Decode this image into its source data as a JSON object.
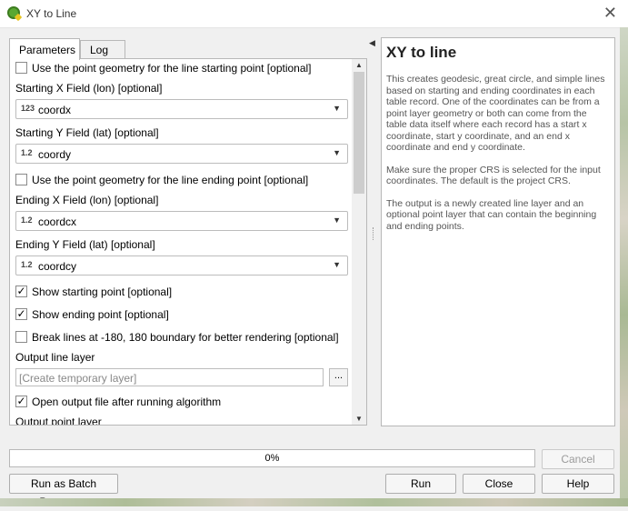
{
  "window": {
    "title": "XY to Line",
    "close_glyph": "✕",
    "app_icon": "qgis-logo-icon"
  },
  "tabs": [
    {
      "label": "Parameters",
      "active": true
    },
    {
      "label": "Log",
      "active": false
    }
  ],
  "params": {
    "use_start_geom": {
      "label": "Use the point geometry for the line starting point [optional]",
      "checked": false
    },
    "start_x": {
      "label": "Starting X Field (lon) [optional]",
      "type_badge": "123",
      "value": "coordx"
    },
    "start_y": {
      "label": "Starting Y Field (lat) [optional]",
      "type_badge": "1.2",
      "value": "coordy"
    },
    "use_end_geom": {
      "label": "Use the point geometry for the line ending point [optional]",
      "checked": false
    },
    "end_x": {
      "label": "Ending X Field (lon) [optional]",
      "type_badge": "1.2",
      "value": "coordcx"
    },
    "end_y": {
      "label": "Ending Y Field (lat) [optional]",
      "type_badge": "1.2",
      "value": "coordcy"
    },
    "show_start": {
      "label": "Show starting point [optional]",
      "checked": true
    },
    "show_end": {
      "label": "Show ending point [optional]",
      "checked": true
    },
    "break_lines": {
      "label": "Break lines at -180, 180 boundary for better rendering [optional]",
      "checked": false
    },
    "output_line": {
      "label": "Output line layer",
      "placeholder": "[Create temporary layer]",
      "browse_label": "..."
    },
    "open_output": {
      "label": "Open output file after running algorithm",
      "checked": true
    },
    "output_point": {
      "label": "Output point layer"
    }
  },
  "help": {
    "title": "XY to line",
    "paragraphs": [
      "This creates geodesic, great circle, and simple lines based on starting and ending coordinates in each table record. One of the coordinates can be from a point layer geometry or both can come from the table data itself where each record has a start x coordinate, start y coordinate, and an end x coordinate and end y coordinate.",
      "Make sure the proper CRS is selected for the input coordinates. The default is the project CRS.",
      "The output is a newly created line layer and an optional point layer that can contain the beginning and ending points."
    ]
  },
  "progress": {
    "percent": 0,
    "label": "0%"
  },
  "buttons": {
    "cancel": "Cancel",
    "batch": "Run as Batch Process...",
    "run": "Run",
    "close": "Close",
    "help": "Help"
  },
  "glyphs": {
    "check": "✓",
    "dropdown": "▼",
    "scroll_up": "▲",
    "scroll_down": "▼",
    "collapse": "◀"
  }
}
